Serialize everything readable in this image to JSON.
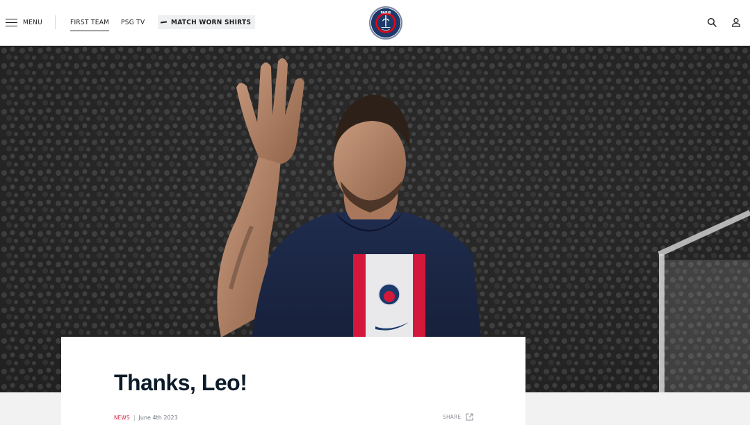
{
  "header": {
    "menu_label": "MENU",
    "nav": [
      {
        "label": "FIRST TEAM",
        "active": true
      },
      {
        "label": "PSG TV",
        "active": false
      },
      {
        "label": "MATCH WORN SHIRTS",
        "active": false
      }
    ],
    "logo": {
      "text": "PARIS"
    }
  },
  "article": {
    "title": "Thanks, Leo!",
    "category": "NEWS",
    "date": "June 4th 2023",
    "share_label": "SHARE"
  },
  "colors": {
    "navy": "#1b3a6b",
    "psg_red": "#d4183b",
    "title": "#0c1b2a",
    "header_bg": "#ffffff",
    "page_bg": "#f2f2f2"
  },
  "icons": [
    "hamburger-icon",
    "dash-icon",
    "psg-logo",
    "search-icon",
    "user-icon",
    "external-link-icon"
  ]
}
